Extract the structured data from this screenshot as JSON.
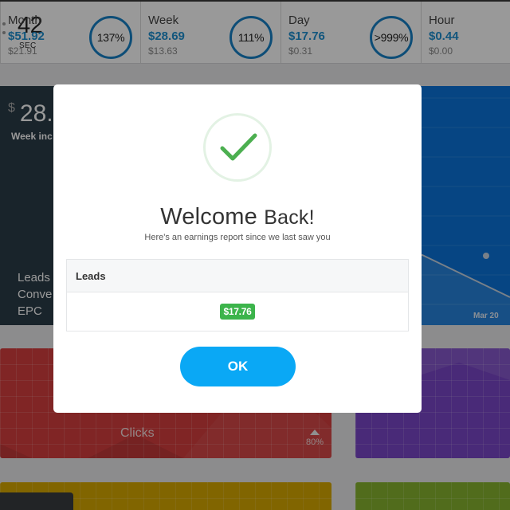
{
  "stats_bar": {
    "timer": {
      "value": "42",
      "unit": "SEC"
    },
    "stats": [
      {
        "period": "Month",
        "amount": "$51.92",
        "previous": "$21.91",
        "percent": "137%"
      },
      {
        "period": "Week",
        "amount": "$28.69",
        "previous": "$13.63",
        "percent": "111%"
      },
      {
        "period": "Day",
        "amount": "$17.76",
        "previous": "$0.31",
        "percent": ">999%"
      },
      {
        "period": "Hour",
        "amount": "$0.44",
        "previous": "$0.00",
        "percent": ""
      }
    ]
  },
  "week_panel": {
    "currency": "$",
    "amount": "28.",
    "subtitle": "Week inc",
    "metrics": [
      "Leads",
      "Conve",
      "EPC"
    ]
  },
  "week_chart": {
    "x_label": "Mar 20"
  },
  "tiles": {
    "clicks": {
      "label": "Clicks",
      "change": "80%",
      "trend": "up"
    }
  },
  "colors": {
    "accent_blue": "#1e8fd0",
    "ok_button": "#0aa8f5",
    "success_green": "#3cb44b",
    "tile_red": "#d53e3e",
    "tile_purple": "#7b47c8",
    "tile_yellow": "#d8a800",
    "tile_green": "#88b52f",
    "chart_blue": "#0a74da"
  },
  "modal": {
    "icon": "check-circle-icon",
    "title_part1": "Welcome",
    "title_part2": "Back!",
    "subtitle": "Here's an earnings report since we last saw you",
    "report": {
      "header": "Leads",
      "value": "$17.76"
    },
    "ok_label": "OK"
  }
}
